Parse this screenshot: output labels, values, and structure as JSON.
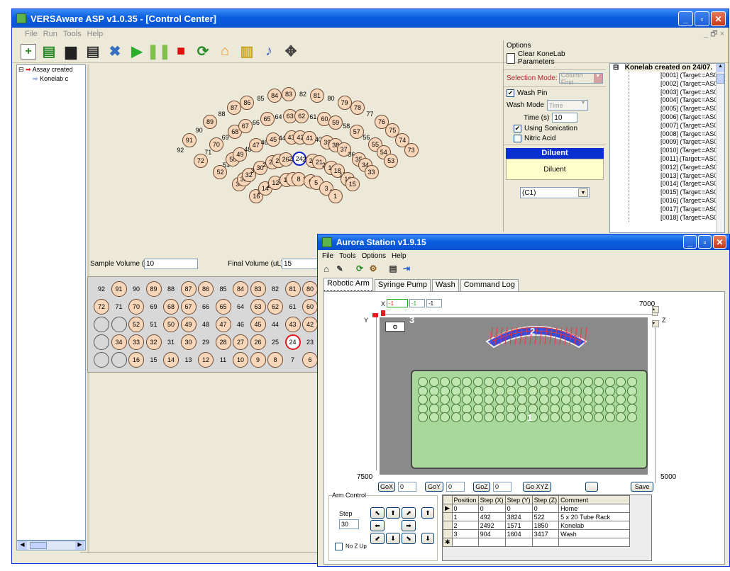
{
  "versa": {
    "title": "VERSAware ASP v1.0.35 - [Control Center]",
    "menu": [
      "File",
      "Run",
      "Tools",
      "Help"
    ],
    "mdi_buttons": "_ 🗗 ×"
  },
  "tree": {
    "root": "Assay created",
    "child": "Konelab c"
  },
  "options": {
    "header": "Options",
    "clear": "Clear KoneLab Parameters",
    "selection_mode_label": "Selection Mode:",
    "selection_mode_value": "Column First",
    "wash_pin": "Wash Pin",
    "wash_mode_label": "Wash Mode",
    "wash_mode_value": "Time",
    "time_label": "Time (s)",
    "time_value": "10",
    "sonication": "Using Sonication",
    "nitric": "Nitric Acid",
    "diluent_header": "Diluent",
    "diluent_button": "Diluent",
    "c1": "(C1)"
  },
  "targets": {
    "header": "Konelab created on 24/07.",
    "items": [
      "[0001] (Target:=AS01) I",
      "[0002] (Target:=AS01) \\",
      "[0003] (Target:=AS01) \\",
      "[0004] (Target:=AS01) \\",
      "[0005] (Target:=AS01) I",
      "[0006] (Target:=AS01) I",
      "[0007] (Target:=AS01) \\",
      "[0008] (Target:=AS01) I",
      "[0009] (Target:=AS01) \\",
      "[0010] (Target:=AS01) I",
      "[0011] (Target:=AS01) I",
      "[0012] (Target:=AS01) I",
      "[0013] (Target:=AS01) I",
      "[0014] (Target:=AS01) \\",
      "[0015] (Target:=AS01) I",
      "[0016] (Target:=AS01) I",
      "[0017] (Target:=AS01) \\",
      "[0018] (Target:=AS01) I"
    ]
  },
  "volumes": {
    "sample_label": "Sample Volume (uL)",
    "sample_value": "10",
    "final_label": "Final Volume (uL)",
    "final_value": "15"
  },
  "aurora": {
    "title": "Aurora Station v1.9.15",
    "menu": [
      "File",
      "Tools",
      "Options",
      "Help"
    ],
    "tabs": [
      "Robotic Arm",
      "Syringe Pump",
      "Wash",
      "Command Log"
    ],
    "x_label": "X",
    "y_label": "Y",
    "z_label": "Z",
    "scale_x": "7000",
    "scale_y": "7500",
    "scale_z": "5000",
    "x_vals": [
      "-1",
      "-1",
      "-1"
    ],
    "station_num": "3",
    "rack_num": "2",
    "tray_num": "1",
    "gox": "GoX",
    "goy": "GoY",
    "goz": "GoZ",
    "goxyz": "Go XYZ",
    "go_vals": [
      "0",
      "0",
      "0"
    ],
    "save": "Save",
    "arm_control": "Arm Control",
    "step_label": "Step",
    "step_value": "30",
    "no_z_up": "No Z Up"
  },
  "positions": {
    "headers": [
      "Position",
      "Step (X)",
      "Step (Y)",
      "Step (Z)",
      "Comment"
    ],
    "rows": [
      [
        "0",
        "0",
        "0",
        "0",
        "Home"
      ],
      [
        "1",
        "492",
        "3824",
        "522",
        "5 x 20 Tube Rack"
      ],
      [
        "2",
        "2492",
        "1571",
        "1850",
        "Konelab"
      ],
      [
        "3",
        "904",
        "1604",
        "3417",
        "Wash"
      ]
    ]
  },
  "colors": {
    "xp_blue": "#0a5ee0",
    "tube_fill": "#f7d6b9",
    "green": "#a8d89a",
    "grid_red": "#e23b3b"
  }
}
